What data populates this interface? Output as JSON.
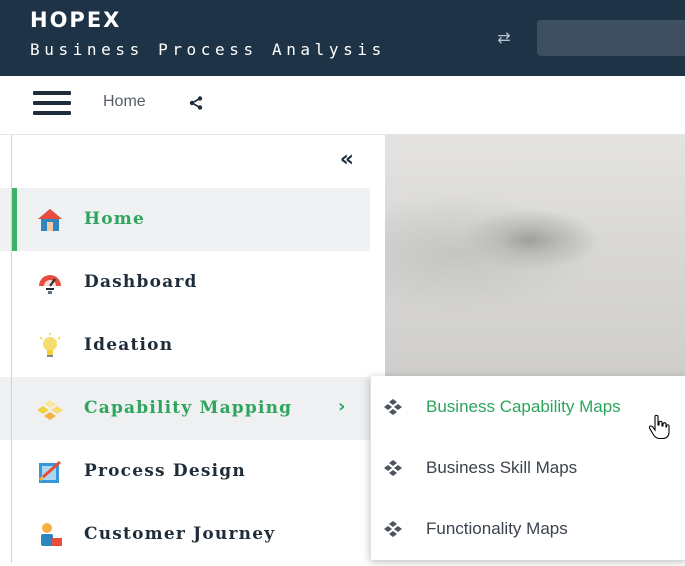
{
  "header": {
    "logo": "HOPEX",
    "subtitle": "Business Process Analysis",
    "swap_icon": "swap-arrows-icon",
    "search_placeholder": ""
  },
  "breadcrumb": {
    "menu_icon": "hamburger-icon",
    "home_label": "Home",
    "share_icon": "share-icon"
  },
  "sidebar": {
    "collapse_icon": "double-chevron-left-icon",
    "items": [
      {
        "label": "Home",
        "icon": "home-icon",
        "state": "active"
      },
      {
        "label": "Dashboard",
        "icon": "gauge-icon",
        "state": "normal"
      },
      {
        "label": "Ideation",
        "icon": "lightbulb-icon",
        "state": "normal"
      },
      {
        "label": "Capability Mapping",
        "icon": "capability-icon",
        "state": "hover",
        "has_submenu": true
      },
      {
        "label": "Process Design",
        "icon": "process-design-icon",
        "state": "normal"
      },
      {
        "label": "Customer Journey",
        "icon": "customer-journey-icon",
        "state": "normal"
      }
    ]
  },
  "submenu": {
    "items": [
      {
        "label": "Business Capability Maps",
        "icon": "map-tiles-icon",
        "highlighted": true
      },
      {
        "label": "Business Skill Maps",
        "icon": "map-tiles-icon",
        "highlighted": false
      },
      {
        "label": "Functionality Maps",
        "icon": "map-tiles-icon",
        "highlighted": false
      }
    ]
  },
  "colors": {
    "topbar": "#1f3347",
    "accent_green": "#2da55c",
    "active_bar": "#3fb16b",
    "text_dark": "#1f2d3a"
  }
}
